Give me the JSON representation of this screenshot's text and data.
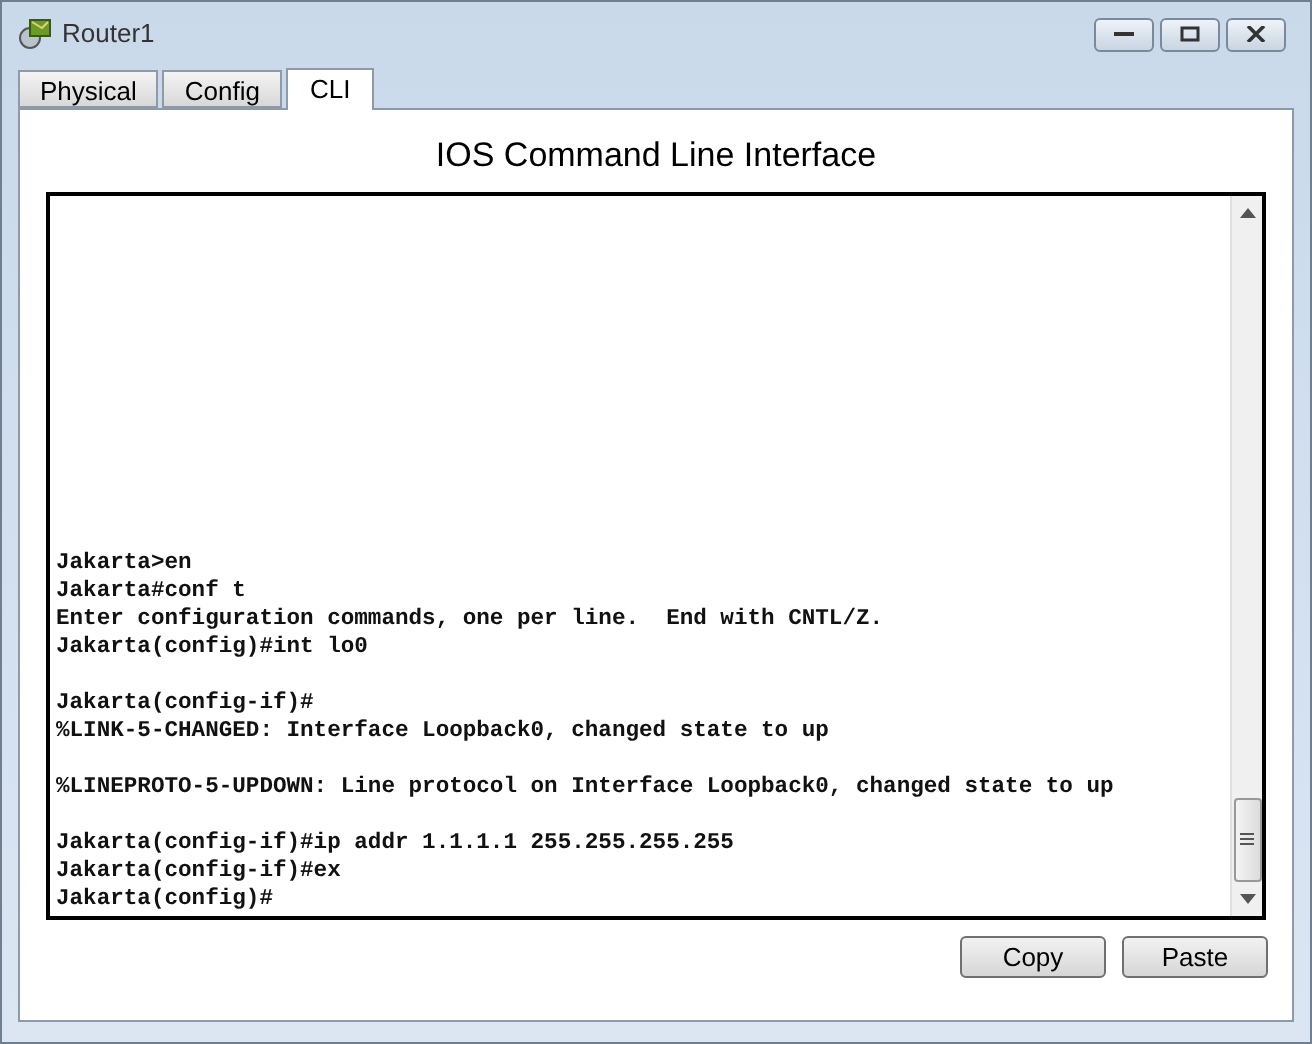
{
  "window": {
    "title": "Router1"
  },
  "tabs": [
    {
      "label": "Physical",
      "selected": false
    },
    {
      "label": "Config",
      "selected": false
    },
    {
      "label": "CLI",
      "selected": true
    }
  ],
  "heading": "IOS Command Line Interface",
  "terminal": {
    "blocks": [
      [
        "Jakarta>en",
        "Jakarta#conf t",
        "Enter configuration commands, one per line.  End with CNTL/Z.",
        "Jakarta(config)#int lo0"
      ],
      [
        "Jakarta(config-if)#",
        "%LINK-5-CHANGED: Interface Loopback0, changed state to up"
      ],
      [
        "%LINEPROTO-5-UPDOWN: Line protocol on Interface Loopback0, changed state to up"
      ],
      [
        "Jakarta(config-if)#ip addr 1.1.1.1 255.255.255.255",
        "Jakarta(config-if)#ex",
        "Jakarta(config)#"
      ]
    ]
  },
  "buttons": [
    "Copy",
    "Paste"
  ]
}
